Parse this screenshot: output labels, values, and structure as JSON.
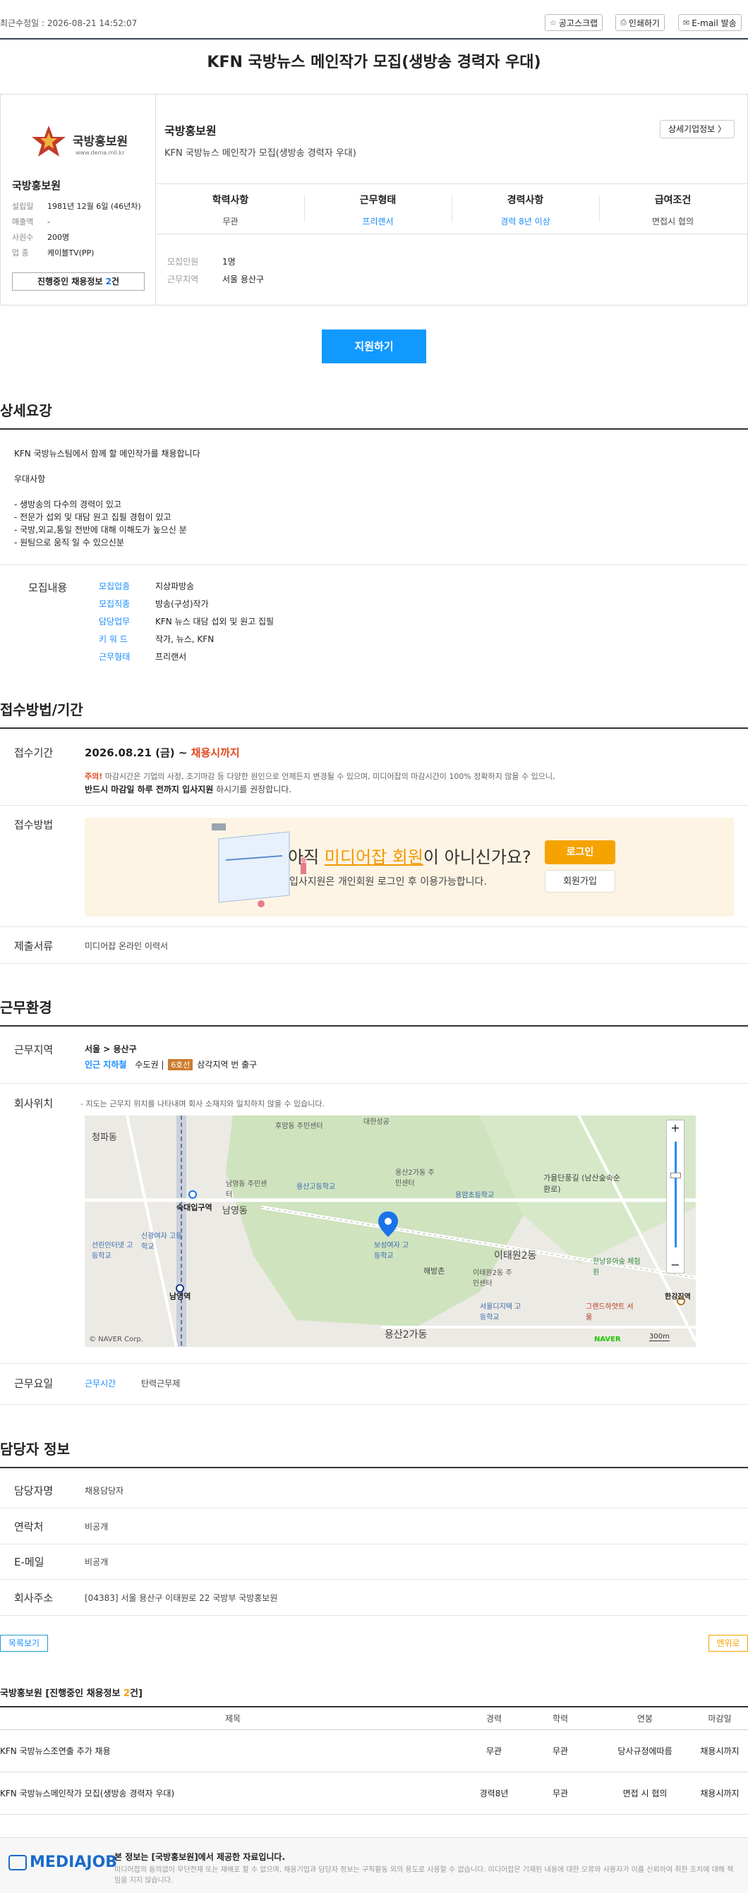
{
  "top": {
    "updated": "최근수정일 : 2026-08-21 14:52:07",
    "scrap_label": "공고스크랩",
    "print_label": "인쇄하기",
    "email_label": "E-mail 발송"
  },
  "job_title": "KFN 국방뉴스 메인작가 모집(생방송 경력자 우대)",
  "company": {
    "logo_text": "국방홍보원",
    "logo_url": "www.dema.mil.kr",
    "name": "국방홍보원",
    "info": [
      {
        "k": "설립일",
        "v": "1981년 12월 6일 (46년차)"
      },
      {
        "k": "매출액",
        "v": "-"
      },
      {
        "k": "사원수",
        "v": "200명"
      },
      {
        "k": "업   종",
        "v": "케이블TV(PP)"
      }
    ],
    "ongoing_prefix": "진행중인 채용정보",
    "ongoing_count": "2",
    "ongoing_suffix": "건",
    "detail_label": "상세기업정보 〉"
  },
  "summary": [
    {
      "h": "학력사항",
      "v": "무관"
    },
    {
      "h": "근무형태",
      "v": "프리랜서"
    },
    {
      "h": "경력사항",
      "v": "경력 8년 이상"
    },
    {
      "h": "급여조건",
      "v": "면접시 협의"
    }
  ],
  "extra": [
    {
      "k": "모집인원",
      "v": "1명"
    },
    {
      "k": "근무지역",
      "v": "서울 용산구"
    }
  ],
  "apply_label": "지원하기",
  "sections": {
    "detail": "상세요강",
    "apply_method": "접수방법/기간",
    "work_env": "근무환경",
    "contact": "담당자 정보"
  },
  "description": "KFN 국방뉴스팀에서 함께 할 메인작가를 채용합니다\n\n우대사항\n\n- 생방송의 다수의 경력이 있고\n- 전문가 섭외 및 대담 원고 집필 경험이 있고\n- 국방,외교,통일 전반에 대해 이해도가 높으신 분\n- 원팀으로 움직 일 수 있으신분",
  "recruit": {
    "label": "모집내용",
    "rows": [
      {
        "k": "모집업종",
        "v": "지상파방송"
      },
      {
        "k": "모집직종",
        "v": "방송(구성)작가"
      },
      {
        "k": "담당업무",
        "v": "KFN 뉴스 대담 섭외 및 원고 집필"
      },
      {
        "k": "키 워 드",
        "v": "작가, 뉴스, KFN"
      },
      {
        "k": "근무형태",
        "v": "프리랜서"
      }
    ]
  },
  "period": {
    "label": "접수기간",
    "date": "2026.08.21 (금) ~ ",
    "until": "채용시까지",
    "notice_red": "주의!",
    "notice1": " 마감시간은 기업의 사정, 조기마감 등 다양한 원인으로 언제든지 변경될 수 있으며, 미디어잡의 마감시간이 100% 정확하지 않을 수 있으니,",
    "notice2_bold": "반드시 마감일 하루 전까지 입사지원",
    "notice2_rest": " 하시기를 권장합니다."
  },
  "method": {
    "label": "접수방법",
    "big_pre": "아직 ",
    "big_em": "미디어잡 회원",
    "big_post": "이 아니신가요?",
    "small": "입사지원은 개인회원 로그인 후 이용가능합니다.",
    "login": "로그인",
    "join": "회원가입"
  },
  "docs": {
    "label": "제출서류",
    "value": "미디어잡 온라인 이력서"
  },
  "location": {
    "label": "근무지역",
    "region": "서울 > 용산구",
    "subway_label": "인근 지하철",
    "subway_pre": "수도권 | ",
    "line": "6호선",
    "subway_post": " 삼각지역 번 출구"
  },
  "map": {
    "label": "회사위치",
    "note": "- 지도는 근무지 위치를 나타내며 회사 소재지와 일치하지 않을 수 있습니다.",
    "places": [
      "청파동",
      "후암동 주민센터",
      "남영동 주민센터",
      "숙대입구역",
      "남영동",
      "용산고등학교",
      "용산2가동 주민센터",
      "용암초등학교",
      "가을단풍길 (남산숲속순환로)",
      "보성여자 고등학교",
      "이태원2동",
      "이태원2동 주민센터",
      "한남유아숲 체험원",
      "해방촌",
      "선린인터넷 고등학교",
      "신광여자 고등학교",
      "남영역",
      "서울디지텍 고등학교",
      "그랜드하얏트 서울",
      "한강진역",
      "용산2가동",
      "대한성공"
    ],
    "copyright": "© NAVER Corp.",
    "scale": "300m",
    "naver": "NAVER"
  },
  "hours": {
    "label": "근무요일",
    "k": "근무시간",
    "v": "탄력근무제"
  },
  "contact": [
    {
      "k": "담당자명",
      "v": "채용담당자"
    },
    {
      "k": "연락처",
      "v": "비공개"
    },
    {
      "k": "E-메일",
      "v": "비공개"
    },
    {
      "k": "회사주소",
      "v": "[04383] 서울 용산구 이태원로 22 국방부 국방홍보원"
    }
  ],
  "list_btn": "목록보기",
  "top_btn": "맨위로",
  "ongoing_list": {
    "title_pre": "국방홍보원 [진행중인 채용정보 ",
    "count": "2",
    "title_post": "건]",
    "headers": [
      "제목",
      "경력",
      "학력",
      "연봉",
      "마감일"
    ],
    "rows": [
      [
        "KFN 국방뉴스조연출 추가 채용",
        "무관",
        "무관",
        "당사규정에따름",
        "채용시까지"
      ],
      [
        "KFN 국방뉴스메인작가 모집(생방송 경력자 우대)",
        "경력8년",
        "무관",
        "면접 시 협의",
        "채용시까지"
      ]
    ]
  },
  "footer": {
    "logo": "MEDIAJOB",
    "t1": "본 정보는 [국방홍보원]에서 제공한 자료입니다.",
    "t2": "미디어잡의 동의없이 무단전재 또는 재배포 할 수 없으며, 채용기업과 담당자 정보는 구직활동 외의 용도로 사용할 수 없습니다. 미디어잡은 기재된 내용에 대한 오류와 사용자가 이를 신뢰하여 취한 조치에 대해 책임을 지지 않습니다."
  }
}
